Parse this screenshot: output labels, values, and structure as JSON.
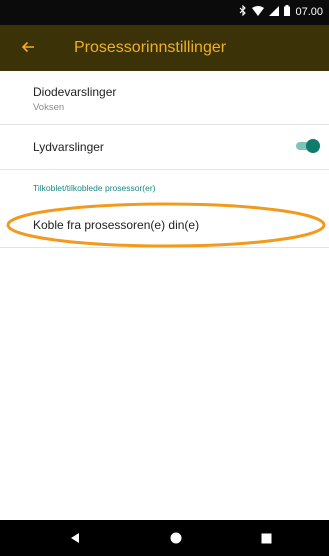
{
  "status_bar": {
    "time": "07.00",
    "icons": [
      "bluetooth-icon",
      "wifi-icon",
      "signal-icon",
      "battery-icon"
    ]
  },
  "app_bar": {
    "title": "Prosessorinnstillinger",
    "back_icon": "arrow-left-icon",
    "background_color": "#3c3208",
    "accent_color": "#f0b020"
  },
  "settings": {
    "diode_alerts": {
      "title": "Diodevarslinger",
      "value": "Voksen"
    },
    "sound_alerts": {
      "title": "Lydvarslinger",
      "enabled": true
    },
    "section_header": "Tilkoblet/tilkoblede prosessor(er)",
    "disconnect": {
      "title": "Koble fra prosessoren(e) din(e)"
    }
  },
  "annotation": {
    "color": "#f29a1e",
    "highlights": "disconnect"
  },
  "nav_bar": {
    "buttons": [
      "back-triangle-icon",
      "home-circle-icon",
      "recents-square-icon"
    ]
  },
  "colors": {
    "toggle_on": "#0f7b6d",
    "toggle_track": "#7cc4ba",
    "section_header": "#17887b"
  }
}
